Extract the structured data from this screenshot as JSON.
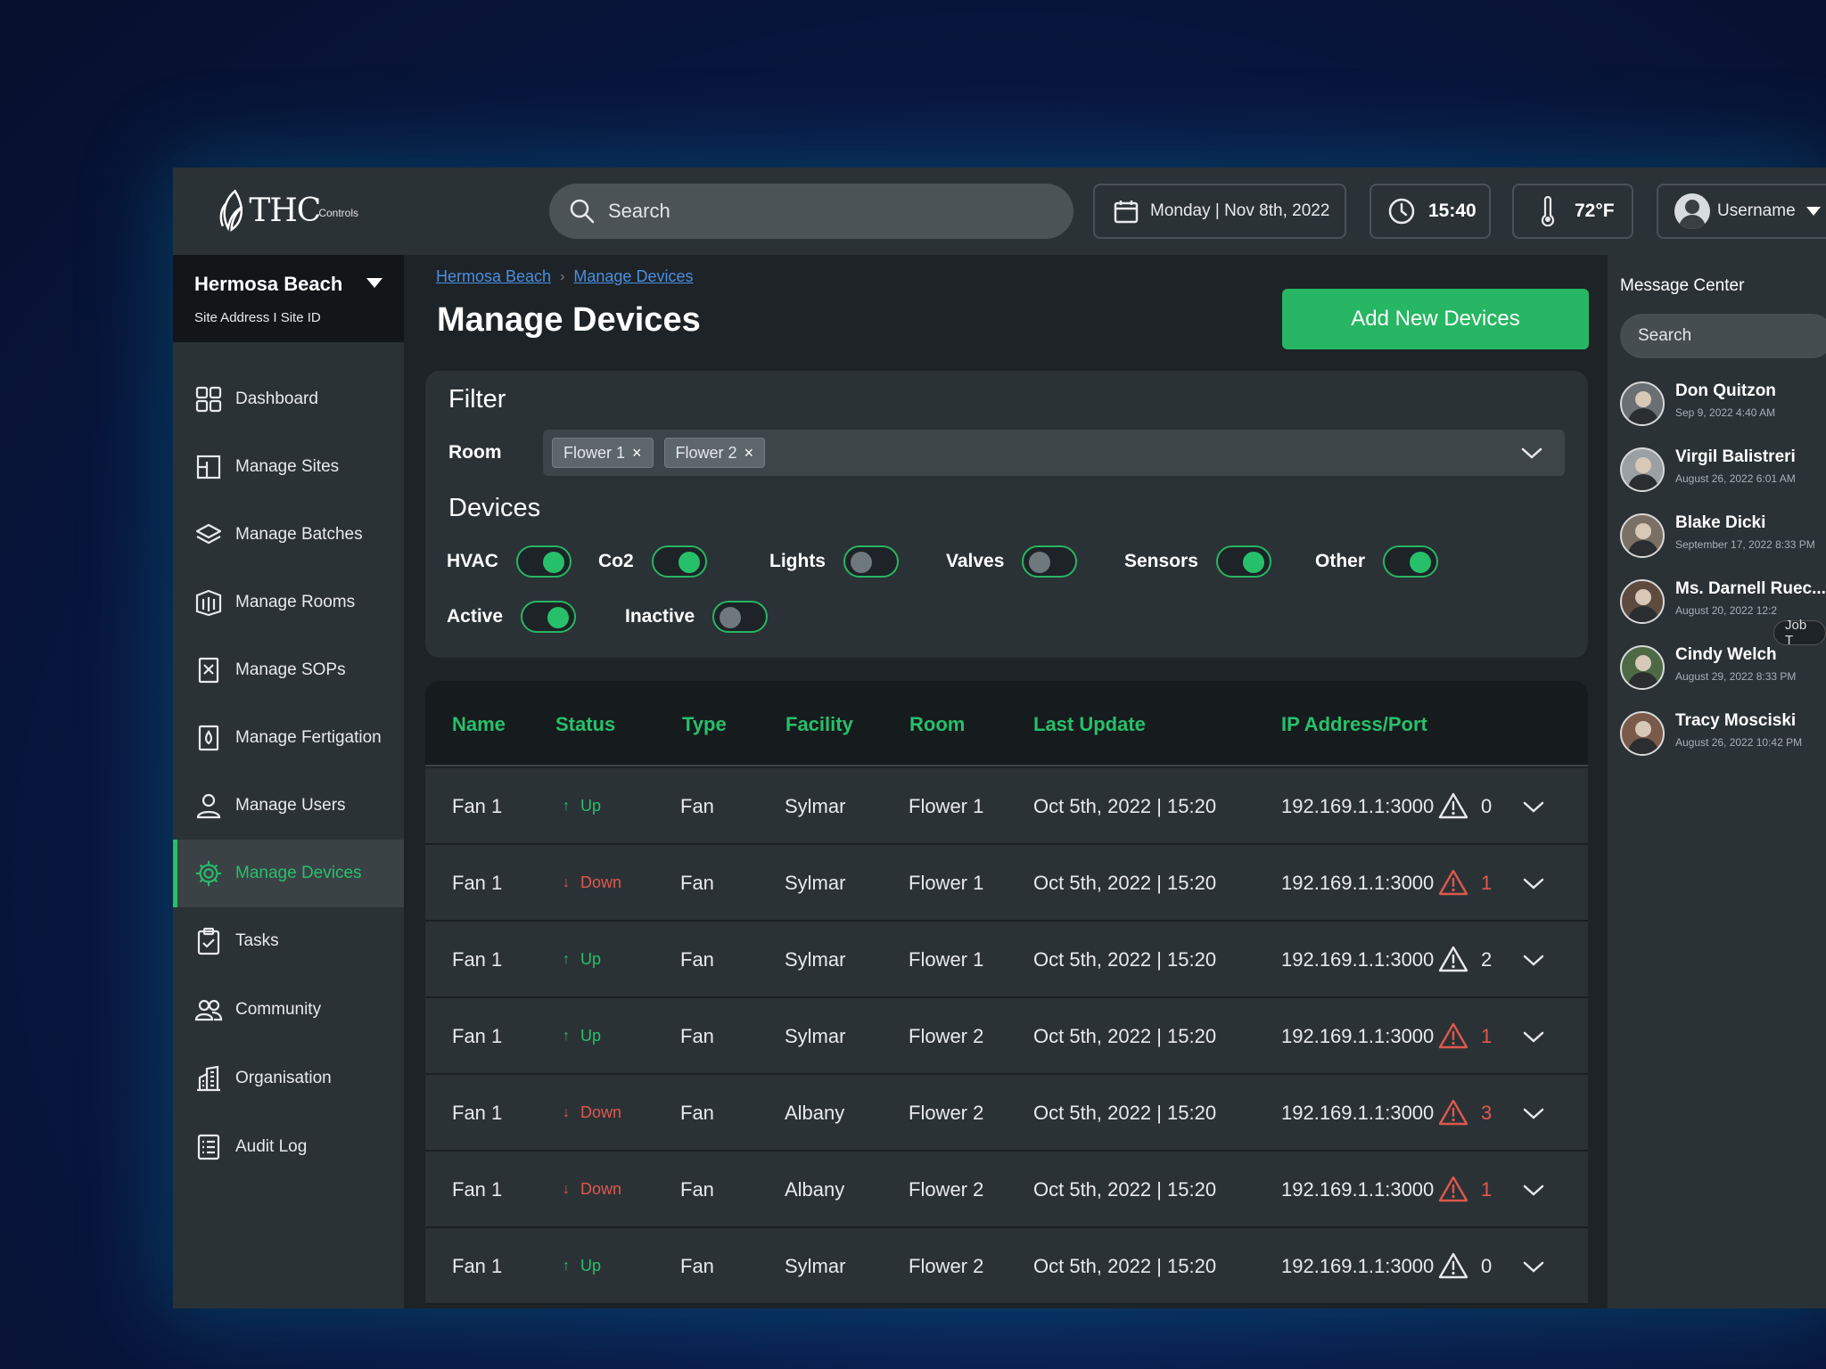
{
  "header": {
    "logo_text": "THC",
    "logo_sub": "Controls",
    "search_placeholder": "Search",
    "date": "Monday | Nov 8th, 2022",
    "time": "15:40",
    "temperature": "72°F",
    "username": "Username"
  },
  "sidebar": {
    "site_name": "Hermosa Beach",
    "site_sub": "Site Address I Site ID",
    "items": [
      {
        "label": "Dashboard",
        "icon": "dashboard-icon"
      },
      {
        "label": "Manage Sites",
        "icon": "sites-icon"
      },
      {
        "label": "Manage Batches",
        "icon": "layers-icon"
      },
      {
        "label": "Manage Rooms",
        "icon": "rooms-icon"
      },
      {
        "label": "Manage SOPs",
        "icon": "sop-icon"
      },
      {
        "label": "Manage Fertigation",
        "icon": "fertigation-icon"
      },
      {
        "label": "Manage Users",
        "icon": "user-icon"
      },
      {
        "label": "Manage Devices",
        "icon": "chip-icon",
        "active": true
      },
      {
        "label": "Tasks",
        "icon": "clipboard-icon"
      },
      {
        "label": "Community",
        "icon": "community-icon"
      },
      {
        "label": "Organisation",
        "icon": "building-icon"
      },
      {
        "label": "Audit Log",
        "icon": "log-icon"
      }
    ]
  },
  "main": {
    "breadcrumb": [
      "Hermosa Beach",
      "Manage Devices"
    ],
    "title": "Manage Devices",
    "add_button": "Add New Devices",
    "filter": {
      "title": "Filter",
      "room_label": "Room",
      "room_chips": [
        "Flower 1",
        "Flower 2"
      ],
      "devices_title": "Devices",
      "device_toggles": [
        {
          "label": "HVAC",
          "on": true
        },
        {
          "label": "Co2",
          "on": true
        },
        {
          "label": "Lights",
          "on": false
        },
        {
          "label": "Valves",
          "on": false
        },
        {
          "label": "Sensors",
          "on": true
        },
        {
          "label": "Other",
          "on": true
        }
      ],
      "status_toggles": [
        {
          "label": "Active",
          "on": true
        },
        {
          "label": "Inactive",
          "on": false
        }
      ]
    },
    "table": {
      "columns": [
        "Name",
        "Status",
        "Type",
        "Facility",
        "Room",
        "Last Update",
        "IP Address/Port"
      ],
      "rows": [
        {
          "name": "Fan 1",
          "status": "Up",
          "type": "Fan",
          "facility": "Sylmar",
          "room": "Flower 1",
          "updated": "Oct 5th, 2022 | 15:20",
          "ip": "192.169.1.1:3000",
          "alerts": "0"
        },
        {
          "name": "Fan 1",
          "status": "Down",
          "type": "Fan",
          "facility": "Sylmar",
          "room": "Flower 1",
          "updated": "Oct 5th, 2022 | 15:20",
          "ip": "192.169.1.1:3000",
          "alerts": "1"
        },
        {
          "name": "Fan 1",
          "status": "Up",
          "type": "Fan",
          "facility": "Sylmar",
          "room": "Flower 1",
          "updated": "Oct 5th, 2022 | 15:20",
          "ip": "192.169.1.1:3000",
          "alerts": "2"
        },
        {
          "name": "Fan 1",
          "status": "Up",
          "type": "Fan",
          "facility": "Sylmar",
          "room": "Flower 2",
          "updated": "Oct 5th, 2022 | 15:20",
          "ip": "192.169.1.1:3000",
          "alerts": "1"
        },
        {
          "name": "Fan 1",
          "status": "Down",
          "type": "Fan",
          "facility": "Albany",
          "room": "Flower 2",
          "updated": "Oct 5th, 2022 | 15:20",
          "ip": "192.169.1.1:3000",
          "alerts": "3"
        },
        {
          "name": "Fan 1",
          "status": "Down",
          "type": "Fan",
          "facility": "Albany",
          "room": "Flower 2",
          "updated": "Oct 5th, 2022 | 15:20",
          "ip": "192.169.1.1:3000",
          "alerts": "1"
        },
        {
          "name": "Fan 1",
          "status": "Up",
          "type": "Fan",
          "facility": "Sylmar",
          "room": "Flower 2",
          "updated": "Oct 5th, 2022 | 15:20",
          "ip": "192.169.1.1:3000",
          "alerts": "0"
        }
      ]
    }
  },
  "message_center": {
    "title": "Message Center",
    "search_placeholder": "Search",
    "job_tag": "Job T",
    "contacts": [
      {
        "name": "Don Quitzon",
        "date": "Sep 9, 2022 4:40 AM"
      },
      {
        "name": "Virgil Balistreri",
        "date": "August 26, 2022 6:01 AM"
      },
      {
        "name": "Blake Dicki",
        "date": "September 17, 2022 8:33 PM"
      },
      {
        "name": "Ms. Darnell Ruec...",
        "date": "August 20, 2022 12:2"
      },
      {
        "name": "Cindy Welch",
        "date": "August 29, 2022 8:33 PM"
      },
      {
        "name": "Tracy Mosciski",
        "date": "August 26, 2022 10:42 PM"
      }
    ]
  },
  "colors": {
    "accent": "#27c06a",
    "status_up": "#27c06a",
    "status_down": "#e0584c",
    "link": "#4a8fe0",
    "panel": "#2b3236",
    "background": "#1d2327"
  }
}
